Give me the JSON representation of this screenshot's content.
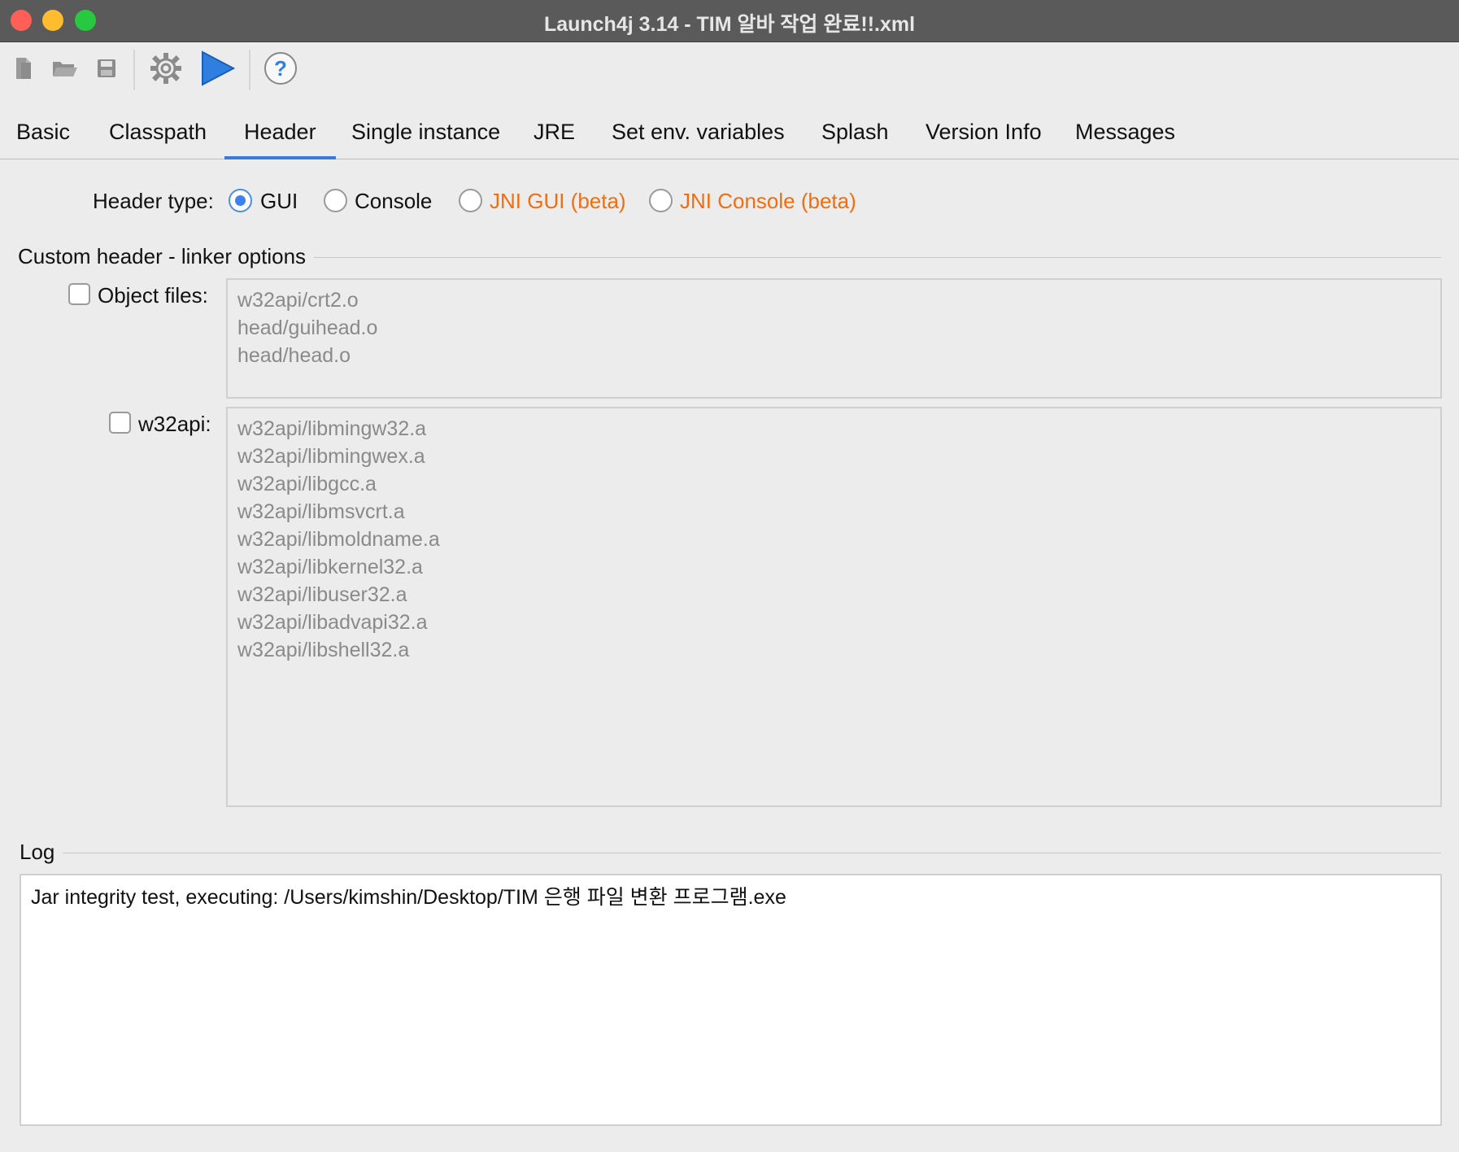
{
  "window": {
    "title": "Launch4j 3.14 - TIM 알바 작업 완료!!.xml"
  },
  "toolbar": {
    "buttons": [
      {
        "icon": "new-file-icon"
      },
      {
        "icon": "open-folder-icon"
      },
      {
        "icon": "save-icon"
      },
      {
        "icon": "gear-icon"
      },
      {
        "icon": "run-icon"
      },
      {
        "icon": "help-icon"
      }
    ]
  },
  "tabs": [
    {
      "label": "Basic"
    },
    {
      "label": "Classpath"
    },
    {
      "label": "Header",
      "active": true
    },
    {
      "label": "Single instance"
    },
    {
      "label": "JRE"
    },
    {
      "label": "Set env. variables"
    },
    {
      "label": "Splash"
    },
    {
      "label": "Version Info"
    },
    {
      "label": "Messages"
    }
  ],
  "header_type": {
    "label": "Header type:",
    "options": [
      {
        "label": "GUI",
        "selected": true
      },
      {
        "label": "Console",
        "selected": false
      },
      {
        "label": "JNI GUI (beta)",
        "selected": false
      },
      {
        "label": "JNI Console (beta)",
        "selected": false
      }
    ],
    "beta_color": "#f06e0e",
    "selected_color": "#3b82f0"
  },
  "custom_header": {
    "title": "Custom header - linker options",
    "object_files": {
      "label": "Object files:",
      "checked": false,
      "lines": [
        "w32api/crt2.o",
        "head/guihead.o",
        "head/head.o"
      ]
    },
    "w32api": {
      "label": "w32api:",
      "checked": false,
      "lines": [
        "w32api/libmingw32.a",
        "w32api/libmingwex.a",
        "w32api/libgcc.a",
        "w32api/libmsvcrt.a",
        "w32api/libmoldname.a",
        "w32api/libkernel32.a",
        "w32api/libuser32.a",
        "w32api/libadvapi32.a",
        "w32api/libshell32.a"
      ]
    }
  },
  "log": {
    "title": "Log",
    "lines": [
      "Jar integrity test, executing: /Users/kimshin/Desktop/TIM 은행 파일 변환 프로그램.exe"
    ]
  },
  "colors": {
    "active_tab": "#3b7bd6",
    "title_bar": "#5a5a5a",
    "run_icon": "#2f7fe0"
  }
}
